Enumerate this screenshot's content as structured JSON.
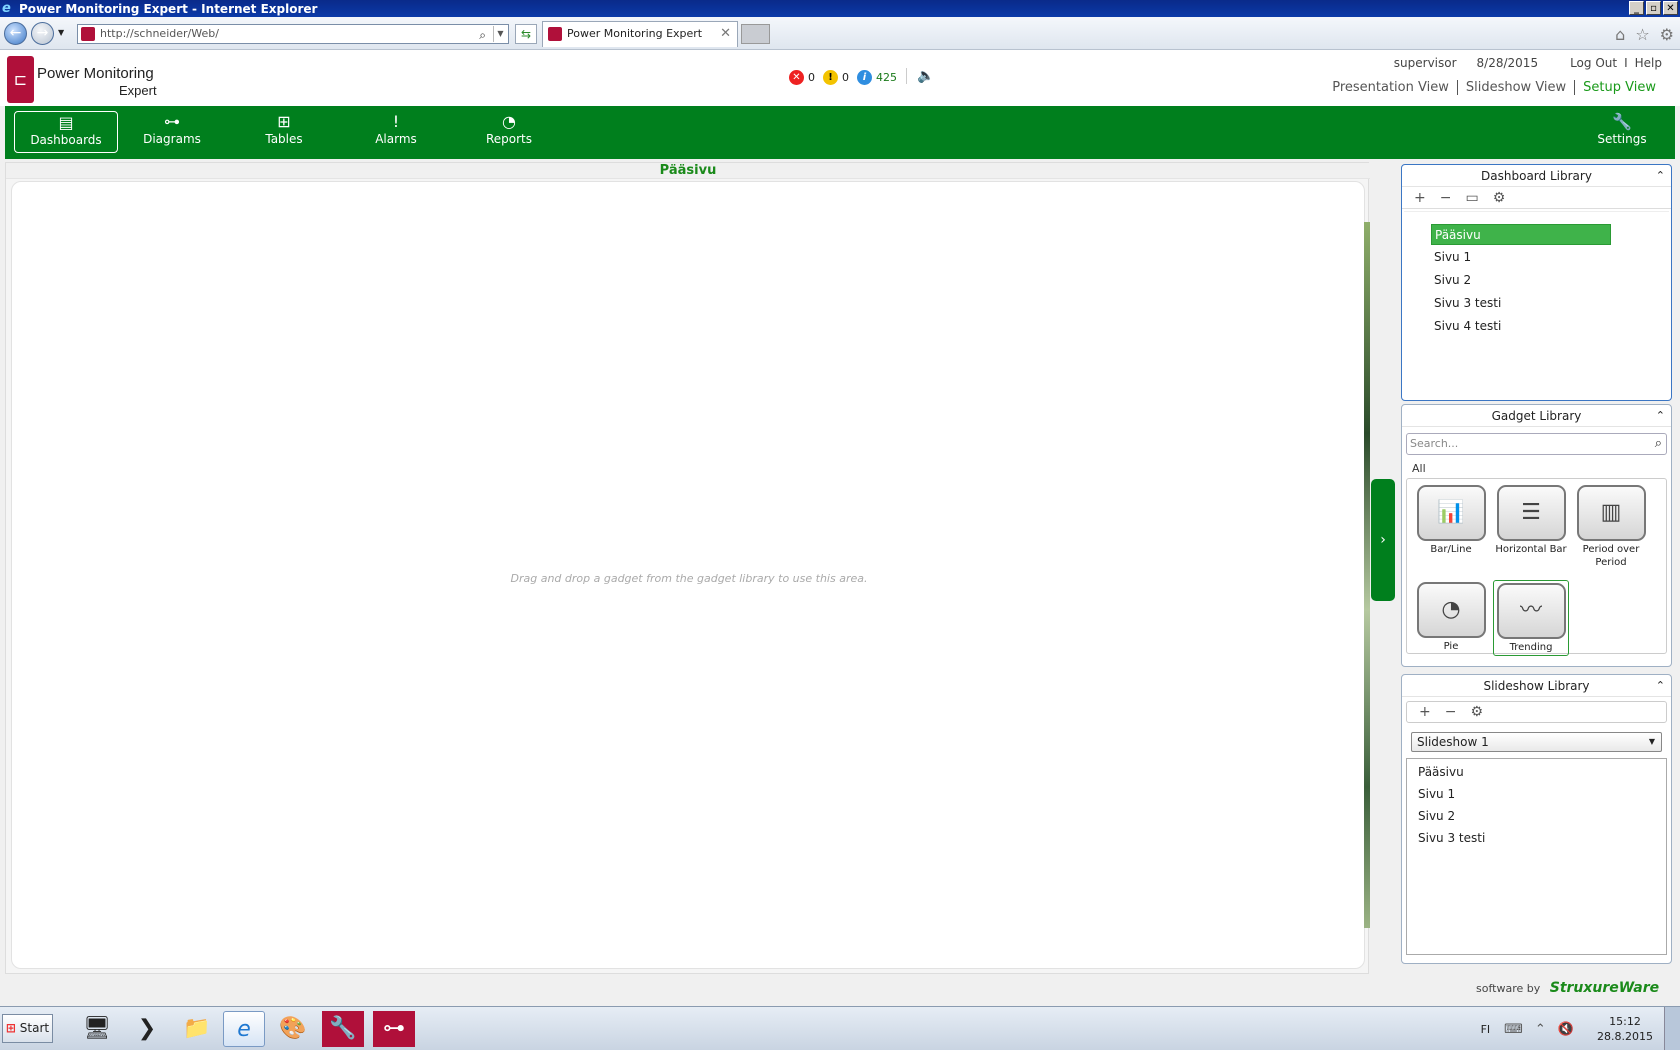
{
  "window": {
    "title": "Power Monitoring Expert - Internet Explorer",
    "controls": [
      "_",
      "▫",
      "✕"
    ]
  },
  "browser": {
    "url": "http://schneider/Web/",
    "tab_title": "Power Monitoring Expert",
    "tab_close": "✕"
  },
  "app": {
    "logo_line1": "Power Monitoring",
    "logo_line2": "Expert",
    "status": {
      "errors": "0",
      "warnings": "0",
      "info": "425"
    },
    "user": "supervisor",
    "date": "8/28/2015",
    "logout": "Log Out",
    "separator": "I",
    "help": "Help",
    "views": [
      "Presentation View",
      "Slideshow View",
      "Setup View"
    ]
  },
  "nav": {
    "items": [
      {
        "label": "Dashboards",
        "icon": "dashboard-icon"
      },
      {
        "label": "Diagrams",
        "icon": "diagram-icon"
      },
      {
        "label": "Tables",
        "icon": "table-icon"
      },
      {
        "label": "Alarms",
        "icon": "alarm-icon"
      },
      {
        "label": "Reports",
        "icon": "report-icon"
      }
    ],
    "settings": "Settings",
    "active": "Dashboards"
  },
  "main": {
    "page_title": "Pääsivu",
    "hint": "Drag and drop a gadget from the gadget library to use this area."
  },
  "dashboard_library": {
    "title": "Dashboard Library",
    "items": [
      "Pääsivu",
      "Sivu 1",
      "Sivu 2",
      "Sivu 3 testi",
      "Sivu 4 testi"
    ],
    "selected": "Pääsivu"
  },
  "gadget_library": {
    "title": "Gadget Library",
    "search_placeholder": "Search...",
    "filter": "All",
    "gadgets": [
      "Bar/Line",
      "Horizontal Bar",
      "Period over Period",
      "Pie",
      "Trending"
    ],
    "selected": "Trending"
  },
  "slideshow_library": {
    "title": "Slideshow Library",
    "selected_slideshow": "Slideshow 1",
    "items": [
      "Pääsivu",
      "Sivu 1",
      "Sivu 2",
      "Sivu 3 testi"
    ]
  },
  "footer": {
    "credit": "software by",
    "brand": "StruxureWare"
  },
  "taskbar": {
    "start": "Start",
    "language": "FI",
    "time": "15:12",
    "date": "28.8.2015"
  },
  "colors": {
    "brand_green": "#007f1d",
    "brand_red": "#b0103a",
    "selected_green": "#3fb34a"
  }
}
